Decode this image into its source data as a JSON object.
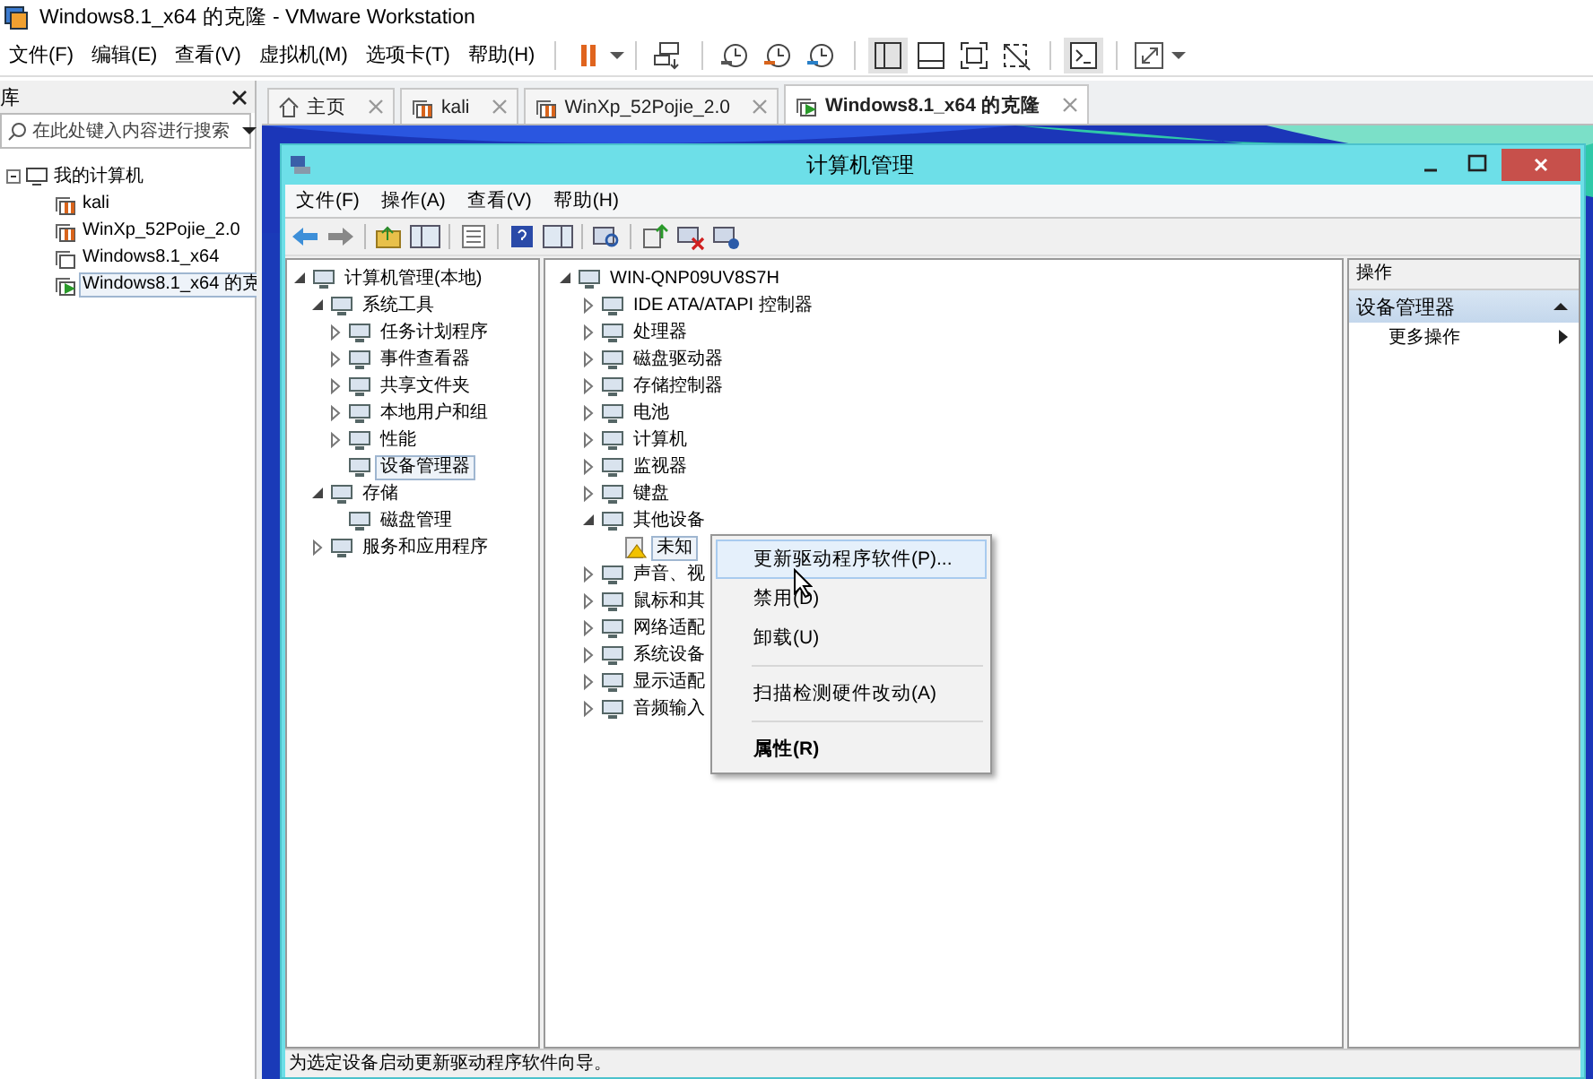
{
  "window": {
    "title": "Windows8.1_x64 的克隆 - VMware Workstation"
  },
  "menu": [
    "文件(F)",
    "编辑(E)",
    "查看(V)",
    "虚拟机(M)",
    "选项卡(T)",
    "帮助(H)"
  ],
  "library": {
    "title": "库",
    "search": {
      "placeholder": "在此处键入内容进行搜索"
    },
    "tree": [
      {
        "label": "我的计算机",
        "kind": "group",
        "expanded": true,
        "selected": false,
        "children": [
          {
            "label": "kali",
            "kind": "suspended",
            "selected": false
          },
          {
            "label": "WinXp_52Pojie_2.0",
            "kind": "suspended",
            "selected": false
          },
          {
            "label": "Windows8.1_x64",
            "kind": "stopped",
            "selected": false
          },
          {
            "label": "Windows8.1_x64 的克",
            "kind": "running",
            "selected": true
          }
        ]
      }
    ]
  },
  "tabs": [
    {
      "label": "主页",
      "kind": "home",
      "selected": false
    },
    {
      "label": "kali",
      "kind": "suspended",
      "selected": false
    },
    {
      "label": "WinXp_52Pojie_2.0",
      "kind": "suspended",
      "selected": false
    },
    {
      "label": "Windows8.1_x64 的克隆",
      "kind": "running",
      "selected": true
    }
  ],
  "mmc": {
    "title": "计算机管理",
    "menu": [
      "文件(F)",
      "操作(A)",
      "查看(V)",
      "帮助(H)"
    ],
    "left_tree": [
      {
        "label": "计算机管理(本地)",
        "kind": "group",
        "expanded": true,
        "selected": false,
        "children": [
          {
            "label": "系统工具",
            "kind": "group",
            "expanded": true,
            "selected": false,
            "children": [
              {
                "label": "任务计划程序",
                "kind": "group",
                "expanded": false,
                "selected": false
              },
              {
                "label": "事件查看器",
                "kind": "group",
                "expanded": false,
                "selected": false
              },
              {
                "label": "共享文件夹",
                "kind": "group",
                "expanded": false,
                "selected": false
              },
              {
                "label": "本地用户和组",
                "kind": "group",
                "expanded": false,
                "selected": false
              },
              {
                "label": "性能",
                "kind": "group",
                "expanded": false,
                "selected": false
              },
              {
                "label": "设备管理器",
                "kind": "item",
                "selected": true
              }
            ]
          },
          {
            "label": "存储",
            "kind": "group",
            "expanded": true,
            "selected": false,
            "children": [
              {
                "label": "磁盘管理",
                "kind": "item",
                "selected": false
              }
            ]
          },
          {
            "label": "服务和应用程序",
            "kind": "group",
            "expanded": false,
            "selected": false
          }
        ]
      }
    ],
    "device_tree": [
      {
        "label": "WIN-QNP09UV8S7H",
        "kind": "group",
        "expanded": true,
        "selected": false,
        "children": [
          {
            "label": "IDE ATA/ATAPI 控制器",
            "kind": "group",
            "expanded": false,
            "selected": false
          },
          {
            "label": "处理器",
            "kind": "group",
            "expanded": false,
            "selected": false
          },
          {
            "label": "磁盘驱动器",
            "kind": "group",
            "expanded": false,
            "selected": false
          },
          {
            "label": "存储控制器",
            "kind": "group",
            "expanded": false,
            "selected": false
          },
          {
            "label": "电池",
            "kind": "group",
            "expanded": false,
            "selected": false
          },
          {
            "label": "计算机",
            "kind": "group",
            "expanded": false,
            "selected": false
          },
          {
            "label": "监视器",
            "kind": "group",
            "expanded": false,
            "selected": false
          },
          {
            "label": "键盘",
            "kind": "group",
            "expanded": false,
            "selected": false
          },
          {
            "label": "其他设备",
            "kind": "group",
            "expanded": true,
            "selected": false,
            "children": [
              {
                "label": "未知",
                "kind": "warning",
                "selected": true
              }
            ]
          },
          {
            "label": "声音、视",
            "kind": "group",
            "expanded": false,
            "selected": false
          },
          {
            "label": "鼠标和其",
            "kind": "group",
            "expanded": false,
            "selected": false
          },
          {
            "label": "网络适配",
            "kind": "group",
            "expanded": false,
            "selected": false
          },
          {
            "label": "系统设备",
            "kind": "group",
            "expanded": false,
            "selected": false
          },
          {
            "label": "显示适配",
            "kind": "group",
            "expanded": false,
            "selected": false
          },
          {
            "label": "音频输入",
            "kind": "group",
            "expanded": false,
            "selected": false
          }
        ]
      }
    ],
    "actions": {
      "title": "操作",
      "section": "设备管理器",
      "items": [
        "更多操作"
      ]
    },
    "context_menu": [
      {
        "kind": "item",
        "label": "更新驱动程序软件(P)...",
        "selected": true,
        "default": false
      },
      {
        "kind": "item",
        "label": "禁用(D)",
        "selected": false,
        "default": false
      },
      {
        "kind": "item",
        "label": "卸载(U)",
        "selected": false,
        "default": false
      },
      {
        "kind": "separator"
      },
      {
        "kind": "item",
        "label": "扫描检测硬件改动(A)",
        "selected": false,
        "default": false
      },
      {
        "kind": "separator"
      },
      {
        "kind": "item",
        "label": "属性(R)",
        "selected": false,
        "default": true
      }
    ],
    "status_bar": "为选定设备启动更新驱动程序软件向导。"
  }
}
